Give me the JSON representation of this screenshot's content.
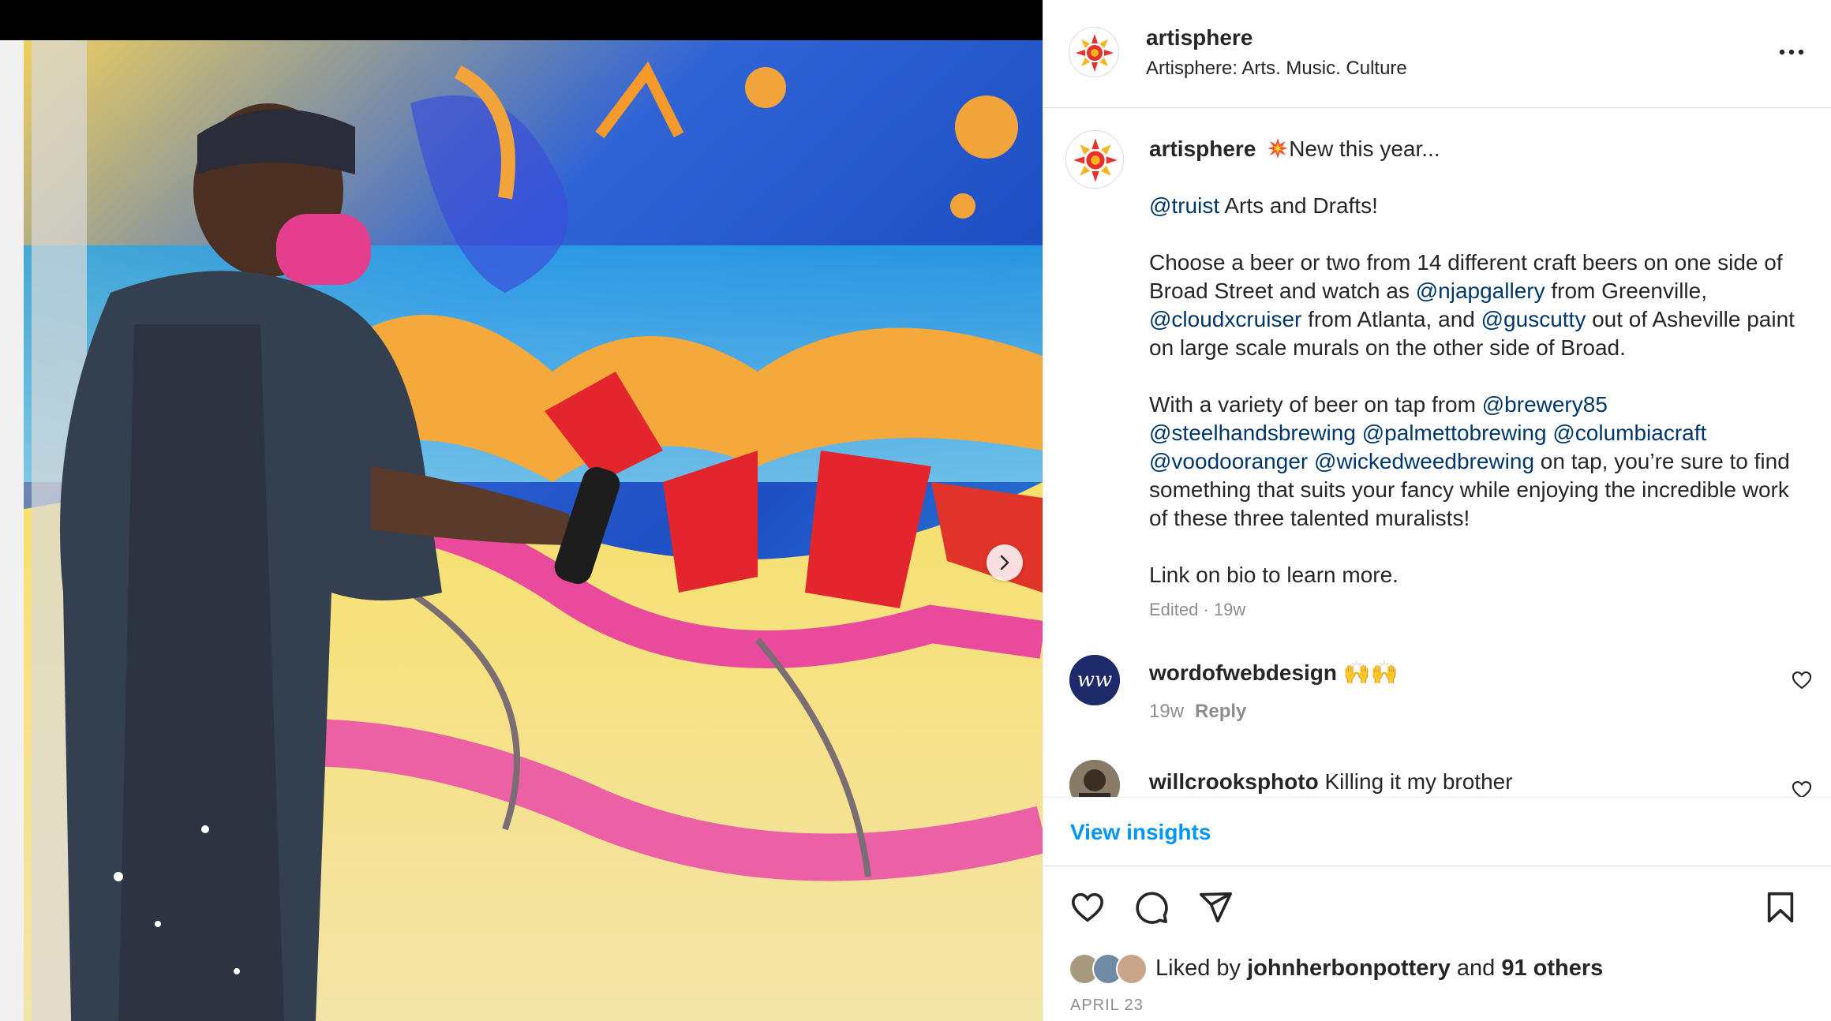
{
  "post": {
    "account": "artisphere",
    "account_subtitle": "Artisphere: Arts. Music. Culture",
    "caption": {
      "username": "artisphere",
      "line1": "New this year...",
      "mention_truist": "@truist",
      "line2": " Arts and Drafts!",
      "p2_a": "Choose a beer or two from 14 different craft beers on one side of Broad Street and watch as ",
      "mention_njap": "@njapgallery",
      "p2_b": " from Greenville, ",
      "mention_cloud": "@cloudxcruiser",
      "p2_c": " from Atlanta, and ",
      "mention_gus": "@guscutty",
      "p2_d": " out of Asheville paint on large scale murals on the other side of Broad.",
      "p3_a": "With a variety of beer on tap from ",
      "mention_b85": "@brewery85",
      "mention_steel": "@steelhandsbrewing",
      "mention_palm": "@palmettobrewing",
      "mention_col": "@columbiacraft",
      "mention_voodoo": "@voodooranger",
      "mention_wicked": "@wickedweedbrewing",
      "p3_b": " on tap, you’re sure to find something that suits your fancy while enjoying the incredible work of these three talented muralists!",
      "p4": "Link on bio to learn more.",
      "meta": "Edited · 19w",
      "emoji": "collision"
    },
    "comments": [
      {
        "username": "wordofwebdesign",
        "text": "🙌🙌",
        "time": "19w",
        "reply": "Reply",
        "avatar_initials": "ww"
      },
      {
        "username": "willcrooksphoto",
        "text": "Killing it my brother"
      }
    ],
    "view_insights": "View insights",
    "likes": {
      "prefix": "Liked by ",
      "user": "johnherbonpottery",
      "middle": " and ",
      "others": "91 others"
    },
    "date": "APRIL 23"
  },
  "colors": {
    "link": "#00376b",
    "insights": "#0095f6",
    "meta": "#8e8e8e",
    "text": "#262626"
  },
  "icons": [
    "sun-logo-icon",
    "more-icon",
    "next-arrow-icon",
    "heart-icon",
    "comment-icon",
    "share-icon",
    "bookmark-icon"
  ]
}
